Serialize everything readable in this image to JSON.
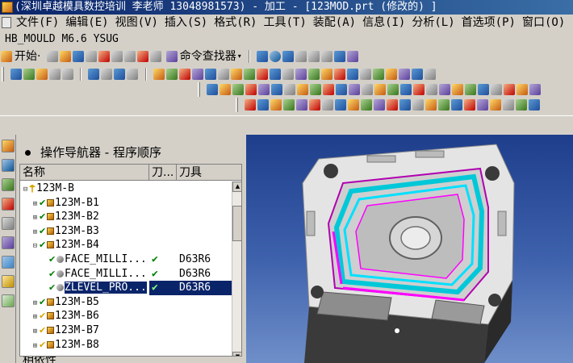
{
  "window": {
    "title": "(深圳卓越模具数控培训 李老师 13048981573) - 加工 - [123MOD.prt  (修改的) ]"
  },
  "menu": [
    "文件(F)",
    "编辑(E)",
    "视图(V)",
    "插入(S)",
    "格式(R)",
    "工具(T)",
    "装配(A)",
    "信息(I)",
    "分析(L)",
    "首选项(P)",
    "窗口(O)"
  ],
  "app_line": "HB_MOULD M6.6 YSUG",
  "toolbar": {
    "start_label": "开始·",
    "command_finder_label": "命令查找器"
  },
  "navigator": {
    "title": "操作导航器 - 程序顺序",
    "columns": [
      "名称",
      "刀...",
      "刀具"
    ],
    "rows": [
      {
        "indent": 0,
        "twisty": "⊟",
        "status": "root",
        "icon": "program-root",
        "name": "123M-B",
        "check": "",
        "tool": ""
      },
      {
        "indent": 1,
        "twisty": "⊞",
        "status": "ok",
        "icon": "program-group",
        "name": "123M-B1",
        "check": "",
        "tool": ""
      },
      {
        "indent": 1,
        "twisty": "⊞",
        "status": "ok",
        "icon": "program-group",
        "name": "123M-B2",
        "check": "",
        "tool": ""
      },
      {
        "indent": 1,
        "twisty": "⊞",
        "status": "ok",
        "icon": "program-group",
        "name": "123M-B3",
        "check": "",
        "tool": ""
      },
      {
        "indent": 1,
        "twisty": "⊟",
        "status": "ok",
        "icon": "program-group",
        "name": "123M-B4",
        "check": "",
        "tool": ""
      },
      {
        "indent": 2,
        "twisty": "",
        "status": "ok",
        "icon": "operation",
        "name": "FACE_MILLI...",
        "check": "✔",
        "tool": "D63R6"
      },
      {
        "indent": 2,
        "twisty": "",
        "status": "ok",
        "icon": "operation",
        "name": "FACE_MILLI...",
        "check": "✔",
        "tool": "D63R6"
      },
      {
        "indent": 2,
        "twisty": "",
        "status": "ok",
        "icon": "operation",
        "name": "ZLEVEL_PRO...",
        "check": "✔",
        "tool": "D63R6",
        "selected": true
      },
      {
        "indent": 1,
        "twisty": "⊞",
        "status": "ok",
        "icon": "program-group",
        "name": "123M-B5",
        "check": "",
        "tool": ""
      },
      {
        "indent": 1,
        "twisty": "⊞",
        "status": "warn",
        "icon": "program-group",
        "name": "123M-B6",
        "check": "",
        "tool": ""
      },
      {
        "indent": 1,
        "twisty": "⊞",
        "status": "warn",
        "icon": "program-group",
        "name": "123M-B7",
        "check": "",
        "tool": ""
      },
      {
        "indent": 1,
        "twisty": "⊞",
        "status": "warn",
        "icon": "program-group",
        "name": "123M-B8",
        "check": "",
        "tool": ""
      }
    ]
  },
  "property_panel_label": "相依性",
  "colors": {
    "titlebar": "#0a246a",
    "selection": "#0a246a",
    "check": "#008000",
    "viewport_top": "#1e3e8c",
    "mold_body": "#e6e6e6",
    "toolpath_cyan": "#00d0e0",
    "toolpath_magenta": "#ff00ff"
  }
}
